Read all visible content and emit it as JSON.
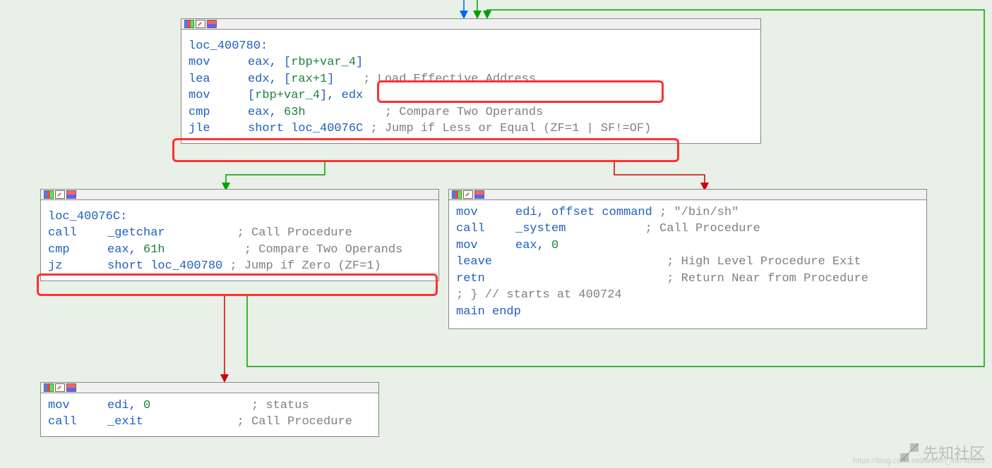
{
  "nodes": {
    "n1": {
      "label": "loc_400780:",
      "lines": [
        {
          "mnem": "mov",
          "ops": [
            {
              "t": "eax, ["
            },
            {
              "v": "rbp+var_4"
            },
            {
              "t": "]"
            }
          ],
          "cmt": ""
        },
        {
          "mnem": "lea",
          "ops": [
            {
              "t": "edx, ["
            },
            {
              "v": "rax+1"
            },
            {
              "t": "]"
            }
          ],
          "cmt": "; Load Effective Address",
          "pad": 4
        },
        {
          "mnem": "mov",
          "ops": [
            {
              "t": "["
            },
            {
              "v": "rbp+var_4"
            },
            {
              "t": "], edx"
            }
          ],
          "cmt": ""
        },
        {
          "mnem": "cmp",
          "ops": [
            {
              "t": "eax, "
            },
            {
              "n": "63h"
            }
          ],
          "cmt": "; Compare Two Operands",
          "pad": 11
        },
        {
          "mnem": "jle",
          "ops": [
            {
              "t": "short loc_40076C"
            }
          ],
          "cmt": "; Jump if Less or Equal (ZF=1 | SF!=OF)",
          "pad": 1
        }
      ]
    },
    "n2": {
      "label": "loc_40076C:",
      "lines": [
        {
          "mnem": "call",
          "ops": [
            {
              "t": "_getchar"
            }
          ],
          "cmt": "; Call Procedure",
          "pad": 10
        },
        {
          "mnem": "cmp",
          "ops": [
            {
              "t": "eax, "
            },
            {
              "n": "61h"
            }
          ],
          "cmt": "; Compare Two Operands",
          "pad": 11
        },
        {
          "mnem": "jz",
          "ops": [
            {
              "t": "short loc_400780"
            }
          ],
          "cmt": "; Jump if Zero (ZF=1)",
          "pad": 1
        }
      ]
    },
    "n3": {
      "lines": [
        {
          "mnem": "mov",
          "ops": [
            {
              "t": "edi, offset command"
            }
          ],
          "cmt": "; \"/bin/sh\"",
          "pad": 1
        },
        {
          "mnem": "call",
          "ops": [
            {
              "t": "_system"
            }
          ],
          "cmt": "; Call Procedure",
          "pad": 11
        },
        {
          "mnem": "mov",
          "ops": [
            {
              "t": "eax, "
            },
            {
              "n": "0"
            }
          ],
          "cmt": ""
        },
        {
          "mnem": "leave",
          "ops": [],
          "cmt": "; High Level Procedure Exit",
          "pad": 21
        },
        {
          "mnem": "retn",
          "ops": [],
          "cmt": "; Return Near from Procedure",
          "pad": 21
        }
      ],
      "tail1": "; } // starts at 400724",
      "tail2": "main endp"
    },
    "n4": {
      "lines": [
        {
          "mnem": "mov",
          "ops": [
            {
              "t": "edi, "
            },
            {
              "n": "0"
            }
          ],
          "cmt": "; status",
          "pad": 14
        },
        {
          "mnem": "call",
          "ops": [
            {
              "t": "_exit"
            }
          ],
          "cmt": "; Call Procedure",
          "pad": 13
        }
      ]
    }
  },
  "watermark": {
    "text": "先知社区",
    "url": "https://blog.csdn.net/weixin_45748963"
  }
}
